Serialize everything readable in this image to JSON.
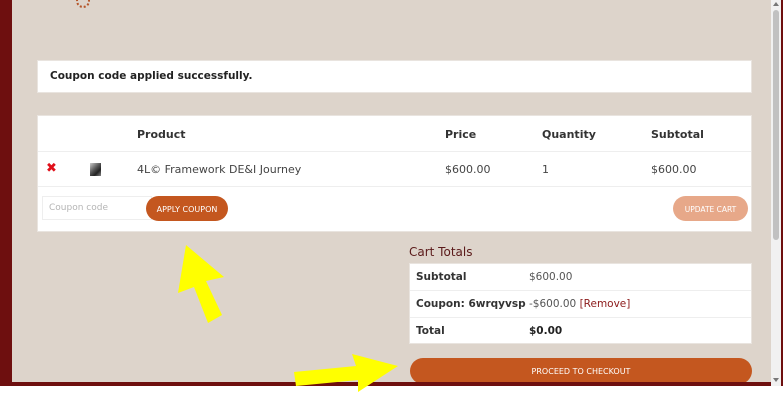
{
  "notice": {
    "text": "Coupon code applied successfully."
  },
  "cart": {
    "headers": {
      "product": "Product",
      "price": "Price",
      "quantity": "Quantity",
      "subtotal": "Subtotal"
    },
    "items": [
      {
        "remove_icon": "✖",
        "name": "4L© Framework DE&I Journey",
        "price": "$600.00",
        "quantity": "1",
        "subtotal": "$600.00"
      }
    ],
    "coupon_placeholder": "Coupon code",
    "apply_label": "APPLY COUPON",
    "update_label": "UPDATE CART"
  },
  "totals": {
    "title": "Cart Totals",
    "subtotal_label": "Subtotal",
    "subtotal_value": "$600.00",
    "coupon_label": "Coupon: 6wrqyvsp",
    "coupon_value": "-$600.00",
    "coupon_remove": "[Remove]",
    "total_label": "Total",
    "total_value": "$0.00"
  },
  "checkout_label": "PROCEED TO CHECKOUT",
  "colors": {
    "frame": "#6e0f0f",
    "background": "#ddd4cb",
    "button": "#c4571f",
    "button_disabled": "#e7a889",
    "remove": "#e0101a",
    "arrow": "#ffff00"
  }
}
